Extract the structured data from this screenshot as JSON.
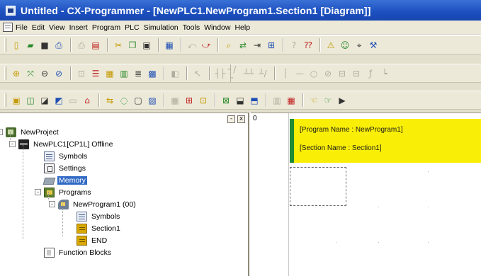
{
  "window": {
    "title": "Untitled - CX-Programmer - [NewPLC1.NewProgram1.Section1 [Diagram]]"
  },
  "menu": {
    "items": [
      "File",
      "Edit",
      "View",
      "Insert",
      "Program",
      "PLC",
      "Simulation",
      "Tools",
      "Window",
      "Help"
    ]
  },
  "toolbars": {
    "row1": [
      {
        "name": "new-file-icon",
        "glyph": "▯"
      },
      {
        "name": "open-folder-icon",
        "glyph": "▰"
      },
      {
        "name": "save-icon",
        "glyph": "■"
      },
      {
        "name": "print-preview-icon",
        "glyph": "⎙"
      },
      {
        "name": "print-icon",
        "glyph": "⎙"
      },
      {
        "name": "preview-icon",
        "glyph": "▤"
      },
      {
        "name": "cut-icon",
        "glyph": "✂"
      },
      {
        "name": "copy-icon",
        "glyph": "❐"
      },
      {
        "name": "paste-icon",
        "glyph": "▣"
      },
      {
        "name": "undo-icon",
        "glyph": "▦"
      },
      {
        "name": "redo-icon",
        "glyph": "⤺"
      },
      {
        "name": "redo2-icon",
        "glyph": "⤻"
      },
      {
        "name": "find-icon",
        "glyph": "⌕"
      },
      {
        "name": "replace-icon",
        "glyph": "⇄"
      },
      {
        "name": "jump-icon",
        "glyph": "⇥"
      },
      {
        "name": "zoom-icon",
        "glyph": "⊞"
      },
      {
        "name": "help-icon",
        "glyph": "?"
      },
      {
        "name": "context-help-icon",
        "glyph": "⁇"
      },
      {
        "name": "warning-icon",
        "glyph": "⚠"
      },
      {
        "name": "user-icon",
        "glyph": "☺"
      },
      {
        "name": "binoculars-icon",
        "glyph": "⌖"
      },
      {
        "name": "tools-icon",
        "glyph": "⚒"
      }
    ],
    "row2": [
      {
        "name": "zoom-in-icon",
        "glyph": "⊕"
      },
      {
        "name": "zoom-fit-icon",
        "glyph": "⤧"
      },
      {
        "name": "zoom-out-icon",
        "glyph": "⊖"
      },
      {
        "name": "zoom-small-icon",
        "glyph": "⊘"
      },
      {
        "name": "grid-toggle-icon",
        "glyph": "⊡"
      },
      {
        "name": "comments-icon",
        "glyph": "☰"
      },
      {
        "name": "rung-comments-icon",
        "glyph": "▦"
      },
      {
        "name": "monitor-icon",
        "glyph": "▥"
      },
      {
        "name": "mnemonic-icon",
        "glyph": "≣"
      },
      {
        "name": "diagram-icon",
        "glyph": "▩"
      },
      {
        "name": "window-icon",
        "glyph": "◧"
      },
      {
        "name": "select-icon",
        "glyph": "↖"
      },
      {
        "name": "contact-no-icon",
        "glyph": "┤├"
      },
      {
        "name": "contact-nc-icon",
        "glyph": "┤/├"
      },
      {
        "name": "contact-or-icon",
        "glyph": "┴┴"
      },
      {
        "name": "contact-ornc-icon",
        "glyph": "┴/"
      },
      {
        "name": "line-v-icon",
        "glyph": "│"
      },
      {
        "name": "line-h-icon",
        "glyph": "—"
      },
      {
        "name": "coil-icon",
        "glyph": "○"
      },
      {
        "name": "coil-nc-icon",
        "glyph": "⊘"
      },
      {
        "name": "instruction-icon",
        "glyph": "⊟"
      },
      {
        "name": "instruction2-icon",
        "glyph": "⊟"
      },
      {
        "name": "function-icon",
        "glyph": "ƒ"
      },
      {
        "name": "function-block-icon",
        "glyph": "┕"
      }
    ],
    "row3": [
      {
        "name": "project-workspace-icon",
        "glyph": "▣"
      },
      {
        "name": "output-window-icon",
        "glyph": "◫"
      },
      {
        "name": "watch-window-icon",
        "glyph": "◪"
      },
      {
        "name": "address-ref-icon",
        "glyph": "◩"
      },
      {
        "name": "properties-icon",
        "glyph": "▭"
      },
      {
        "name": "cross-ref-icon",
        "glyph": "⌂"
      },
      {
        "name": "online-icon",
        "glyph": "⇆"
      },
      {
        "name": "monitoring-icon",
        "glyph": "◌"
      },
      {
        "name": "diff-icon",
        "glyph": "▢"
      },
      {
        "name": "compare-icon",
        "glyph": "▨"
      },
      {
        "name": "program-mode-icon",
        "glyph": "▦"
      },
      {
        "name": "run-mode-icon",
        "glyph": "⊞"
      },
      {
        "name": "monitor-mode-icon",
        "glyph": "⊡"
      },
      {
        "name": "transfer-to-icon",
        "glyph": "⊠"
      },
      {
        "name": "transfer-from-icon",
        "glyph": "⬓"
      },
      {
        "name": "compare-plc-icon",
        "glyph": "⬒"
      },
      {
        "name": "compile-icon",
        "glyph": "▥"
      },
      {
        "name": "compile-all-icon",
        "glyph": "▦"
      },
      {
        "name": "back-icon",
        "glyph": "☜"
      },
      {
        "name": "forward-icon",
        "glyph": "☞"
      },
      {
        "name": "play-icon",
        "glyph": "▶"
      }
    ]
  },
  "workspace": {
    "tree": [
      {
        "label": "NewProject",
        "icon": "project-icon",
        "level": 0,
        "expander": "-"
      },
      {
        "label": "NewPLC1[CP1L] Offline",
        "icon": "plc-icon",
        "level": 1,
        "expander": "-"
      },
      {
        "label": "Symbols",
        "icon": "symbols-icon",
        "level": 2
      },
      {
        "label": "Settings",
        "icon": "settings-icon",
        "level": 2
      },
      {
        "label": "Memory",
        "icon": "memory-icon",
        "level": 2,
        "selected": true
      },
      {
        "label": "Programs",
        "icon": "programs-icon",
        "level": 2,
        "expander": "-"
      },
      {
        "label": "NewProgram1 (00)",
        "icon": "program-icon",
        "level": 3,
        "expander": "-"
      },
      {
        "label": "Symbols",
        "icon": "symbols-icon",
        "level": 4
      },
      {
        "label": "Section1",
        "icon": "section-icon",
        "level": 4
      },
      {
        "label": "END",
        "icon": "section-icon",
        "level": 4
      },
      {
        "label": "Function Blocks",
        "icon": "function-blocks-icon",
        "level": 2
      }
    ],
    "pane_buttons": [
      "-",
      "x"
    ]
  },
  "diagram": {
    "rung_number": "0",
    "program_name": "[Program Name : NewProgram1]",
    "section_name": "[Section Name : Section1]",
    "header_color": "#f9ee06",
    "rung_bar_color": "#1e8a36"
  }
}
